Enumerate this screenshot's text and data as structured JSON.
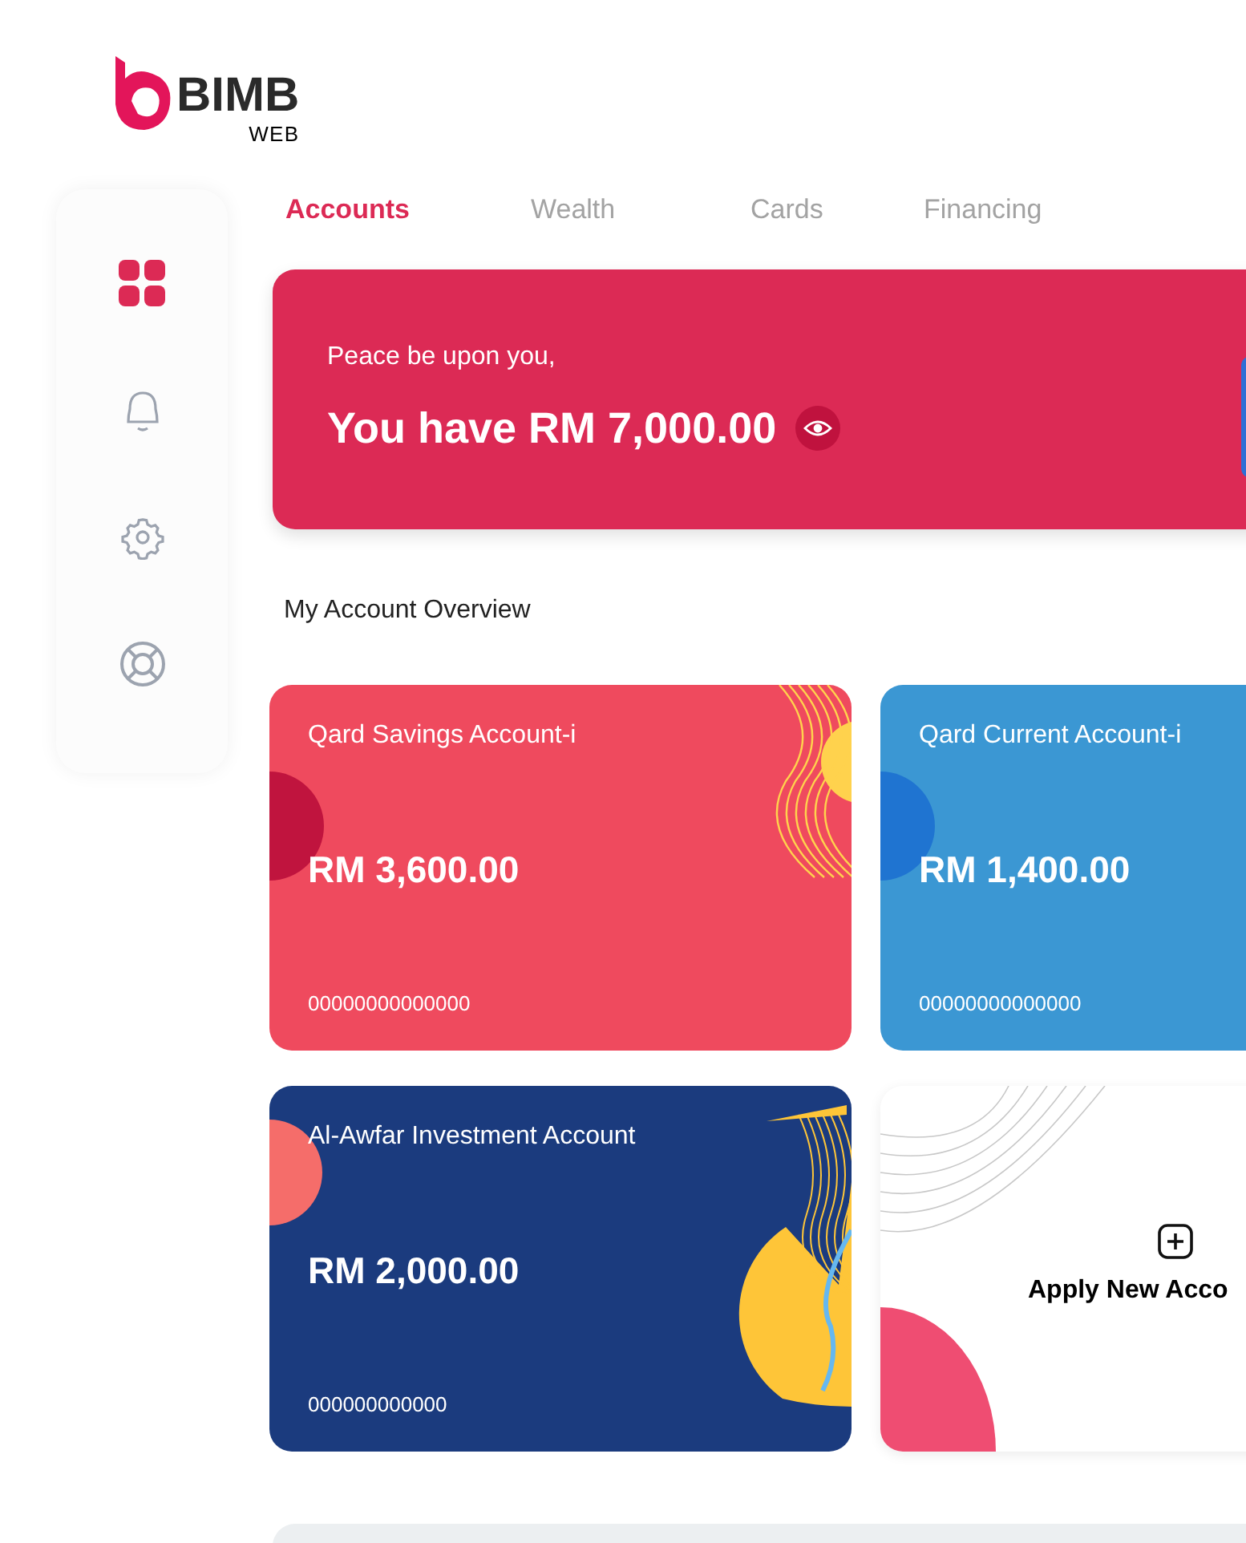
{
  "logo": {
    "brand": "BIMB",
    "sub": "WEB"
  },
  "sidebar": {
    "items": [
      {
        "kind": "dashboard",
        "selected": true
      },
      {
        "kind": "notifications",
        "selected": false
      },
      {
        "kind": "settings",
        "selected": false
      },
      {
        "kind": "help",
        "selected": false
      }
    ]
  },
  "tabs": [
    {
      "label": "Accounts",
      "selected": true
    },
    {
      "label": "Wealth",
      "selected": false
    },
    {
      "label": "Cards",
      "selected": false
    },
    {
      "label": "Financing",
      "selected": false
    }
  ],
  "banner": {
    "greeting": "Peace be upon you,",
    "balance": "You have RM 7,000.00"
  },
  "overview": {
    "title": "My Account Overview"
  },
  "accounts": [
    {
      "kind": "account",
      "name": "Qard Savings Account-i",
      "amount": "RM 3,600.00",
      "number": "00000000000000",
      "color": "#ef4a5e"
    },
    {
      "kind": "account",
      "name": "Qard Current Account-i",
      "amount": "RM 1,400.00",
      "number": "00000000000000",
      "color": "#3b97d3"
    },
    {
      "kind": "account",
      "name": "Al-Awfar Investment Account",
      "amount": "RM 2,000.00",
      "number": "000000000000",
      "color": "#1b3b7e"
    },
    {
      "kind": "apply",
      "label": "Apply New Acco"
    }
  ]
}
